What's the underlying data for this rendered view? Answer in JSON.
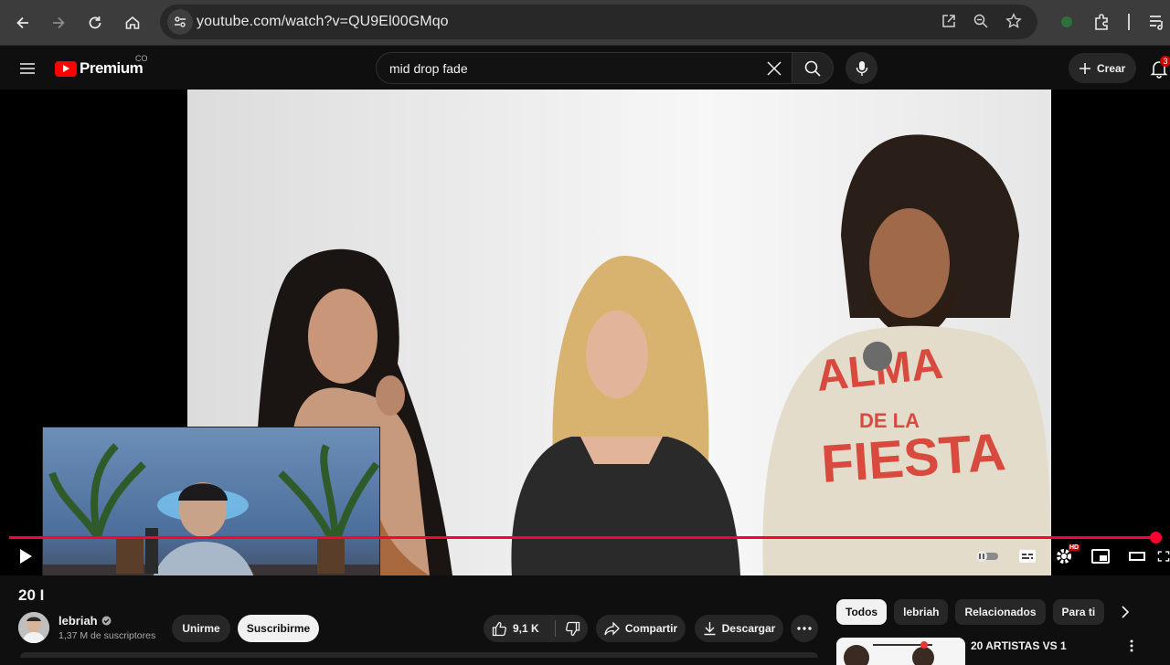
{
  "browser": {
    "url": "youtube.com/watch?v=QU9El00GMqo"
  },
  "header": {
    "logo_text": "Premium",
    "country_code": "CO",
    "search_query": "mid drop fade",
    "create_label": "Crear",
    "notification_count": "3"
  },
  "player": {
    "progress_fraction": 0.995,
    "quality_badge": "HD"
  },
  "video": {
    "title_fragment": "20 I",
    "channel_name": "lebriah",
    "subscribers": "1,37 M de suscriptores",
    "join_label": "Unirme",
    "subscribe_label": "Suscribirme",
    "likes": "9,1 K",
    "share_label": "Compartir",
    "download_label": "Descargar"
  },
  "chips": [
    "Todos",
    "lebriah",
    "Relacionados",
    "Para ti"
  ],
  "recommendation": {
    "title": "20 ARTISTAS VS 1"
  },
  "colors": {
    "accent": "#ff0033",
    "background": "#0f0f0f",
    "surface": "#272727"
  }
}
